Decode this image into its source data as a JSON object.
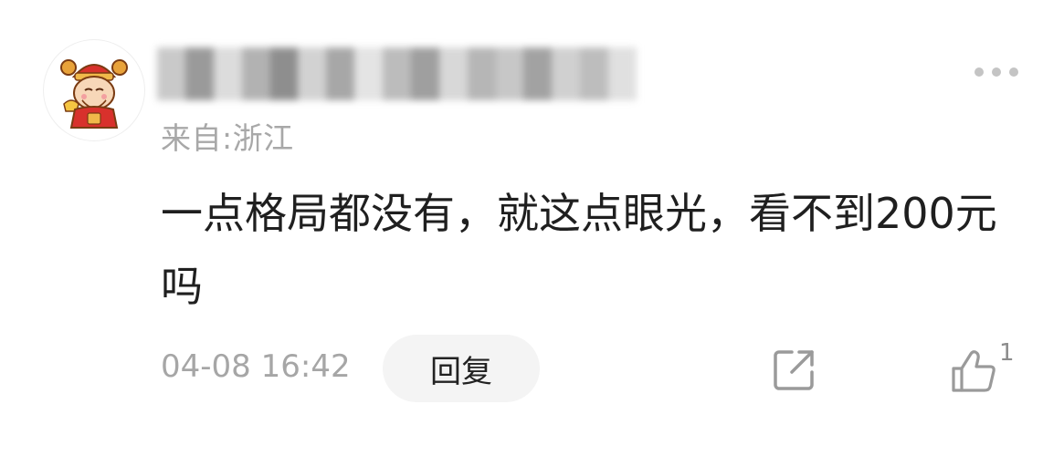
{
  "comment": {
    "location": "来自:浙江",
    "content": "一点格局都没有，就这点眼光，看不到200元吗",
    "timestamp": "04-08 16:42",
    "reply_label": "回复",
    "like_count": "1"
  },
  "icons": {
    "more": "more-dots-icon",
    "share": "share-icon",
    "like": "thumbs-up-icon",
    "avatar": "caishen-avatar"
  },
  "colors": {
    "text_primary": "#1f1f1f",
    "text_secondary": "#a8a8a8",
    "reply_bg": "#f4f4f4"
  }
}
